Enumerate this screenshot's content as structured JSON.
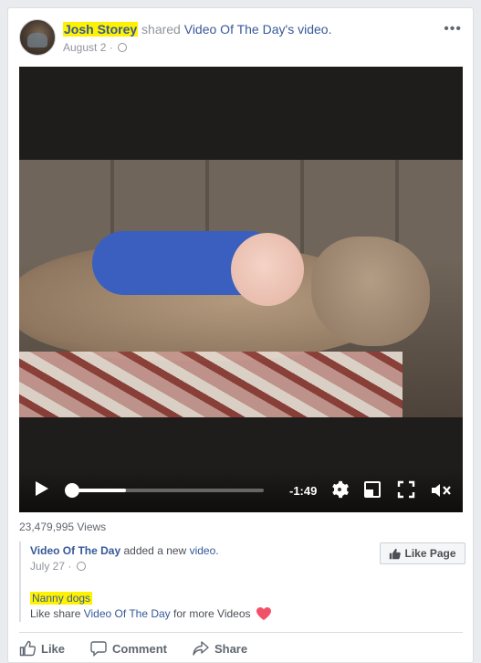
{
  "post": {
    "author": "Josh Storey",
    "shared_word": "shared",
    "page_name": "Video Of The Day",
    "possessive": "'s",
    "object": "video.",
    "date": "August 2",
    "separator": "·"
  },
  "video": {
    "time_remaining": "-1:49",
    "progress": 0.29,
    "views": "23,479,995 Views"
  },
  "shared_post": {
    "page_name": "Video Of The Day",
    "added_text": "added a new",
    "object": "video.",
    "date": "July 27",
    "separator": "·",
    "like_page_label": "Like Page",
    "tag": "Nanny dogs",
    "desc_prefix": "Like share",
    "desc_link": "Video Of The Day",
    "desc_suffix": "for more Videos"
  },
  "actions": {
    "like": "Like",
    "comment": "Comment",
    "share": "Share"
  },
  "colors": {
    "link": "#365899",
    "highlight": "#fff200",
    "heart": "#f25268"
  },
  "icons": {
    "menu": "more-options-icon",
    "privacy": "globe-icon",
    "play": "play-icon",
    "settings": "gear-icon",
    "pip": "picture-in-picture-icon",
    "fullscreen": "fullscreen-icon",
    "mute": "mute-icon",
    "thumb": "thumbs-up-icon",
    "heart": "heart-icon",
    "comment": "comment-icon",
    "share": "share-icon"
  }
}
